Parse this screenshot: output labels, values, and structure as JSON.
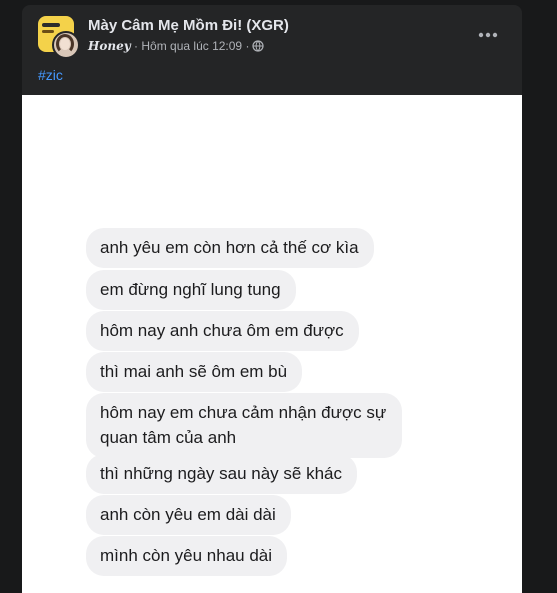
{
  "post": {
    "group_name": "Mày Câm Mẹ Mồm Đi! (XGR)",
    "author": "𝑯𝒐𝒏𝒆𝒚",
    "timestamp": "Hôm qua lúc 12:09",
    "separator": "·",
    "privacy_icon": "globe-icon",
    "more_icon": "more-options-icon",
    "hashtag": "#zic"
  },
  "messages": [
    "anh yêu em còn hơn cả thế cơ kìa",
    "em đừng nghĩ lung tung",
    "hôm nay anh chưa ôm em được",
    "thì mai anh sẽ ôm em bù",
    "hôm nay em chưa cảm nhận được sự quan tâm của anh",
    "thì những ngày sau này sẽ khác",
    "anh còn yêu em dài dài",
    "mình còn yêu nhau dài"
  ],
  "colors": {
    "background": "#18191a",
    "card": "#242526",
    "link": "#4599ff",
    "bubble": "#f0f0f2"
  }
}
